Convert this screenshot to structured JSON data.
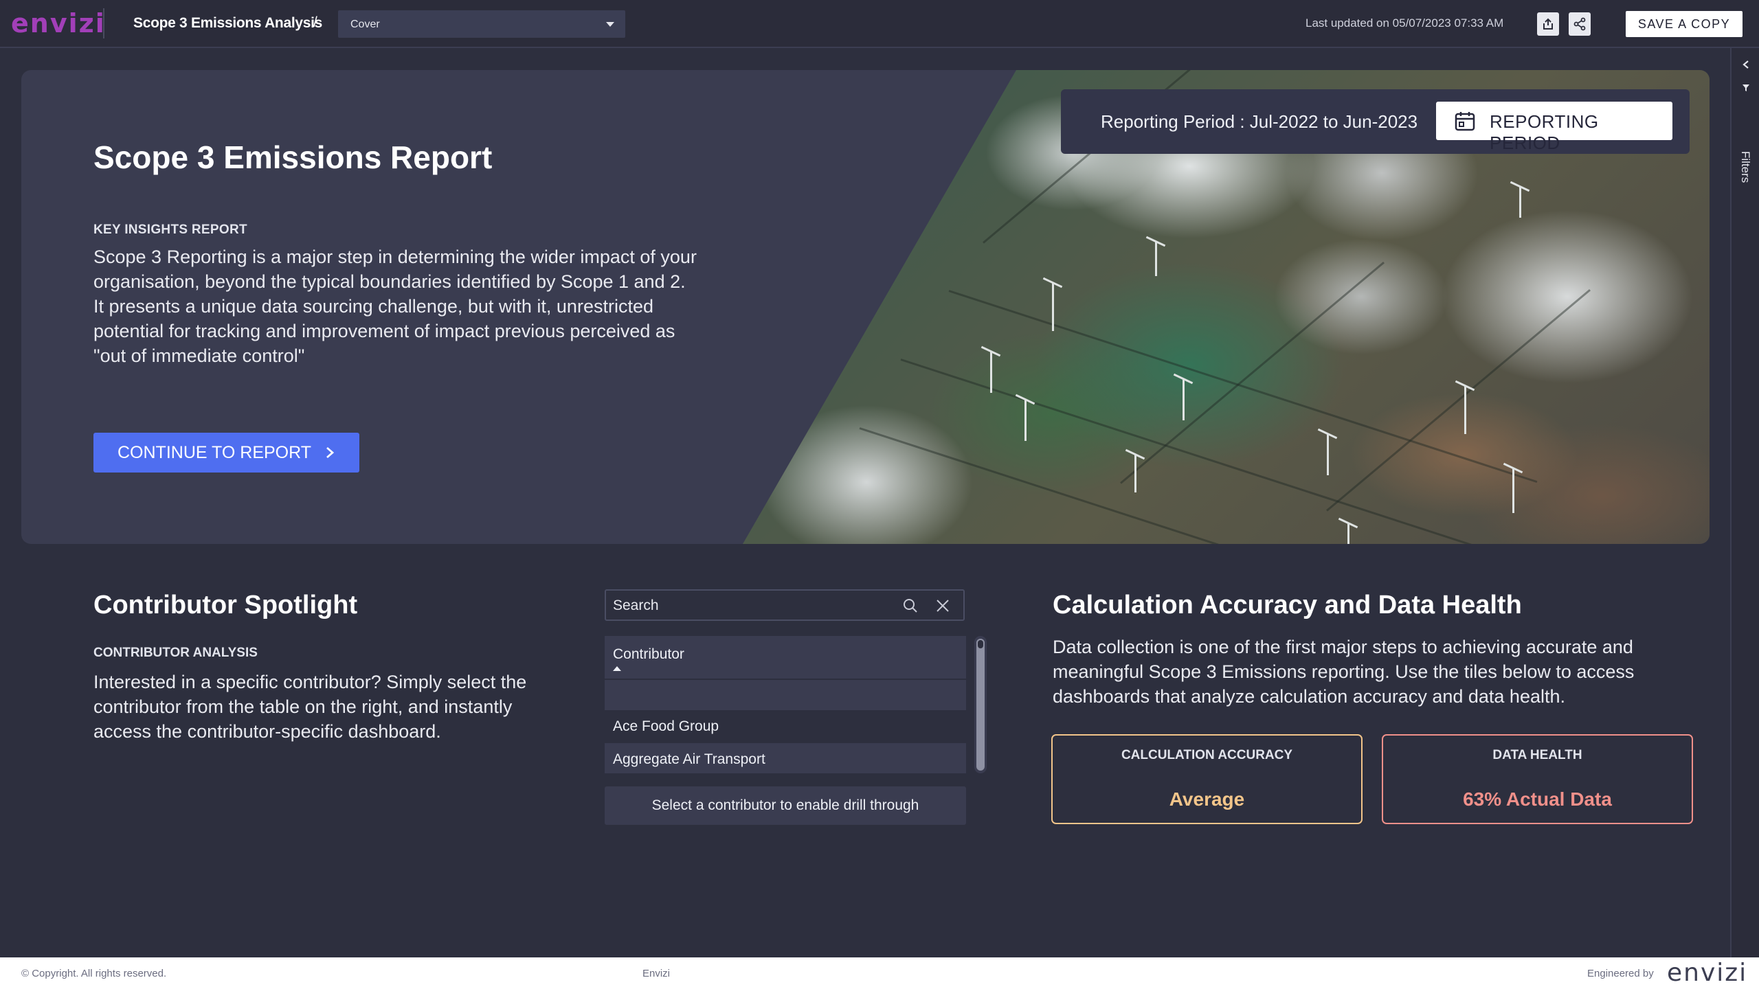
{
  "app": {
    "logo_text": "envizi",
    "report_name": "Scope 3 Emissions Analysis",
    "breadcrumb_separator": "/",
    "page_select": {
      "selected": "Cover"
    },
    "last_updated": "Last updated on 05/07/2023 07:33 AM",
    "save_copy_label": "SAVE A COPY",
    "filters_label": "Filters"
  },
  "hero": {
    "title": "Scope 3 Emissions Report",
    "eyebrow": "KEY INSIGHTS REPORT",
    "body": "Scope 3 Reporting is a major step in determining the wider impact of your organisation, beyond the typical boundaries identified by Scope 1 and 2. It presents a unique data sourcing challenge, but with it, unrestricted potential for tracking and improvement of impact previous perceived as \"out of immediate control\"",
    "continue_label": "CONTINUE TO REPORT",
    "reporting_period_text": "Reporting Period : Jul-2022 to Jun-2023",
    "reporting_period_button": "REPORTING PERIOD"
  },
  "contributor": {
    "title": "Contributor Spotlight",
    "eyebrow": "CONTRIBUTOR ANALYSIS",
    "body": "Interested in a specific contributor? Simply select the contributor from the table on the right, and instantly access the contributor-specific dashboard.",
    "search_placeholder": "Search",
    "table_header": "Contributor",
    "rows": [
      "",
      "Ace Food Group",
      "Aggregate Air Transport"
    ],
    "drill_label": "Select a contributor to enable drill through"
  },
  "accuracy": {
    "title": "Calculation Accuracy and Data Health",
    "body": "Data collection is one of the first major steps to achieving accurate and meaningful Scope 3 Emissions reporting. Use the tiles below to access dashboards that analyze calculation accuracy and data health.",
    "tiles": [
      {
        "label": "CALCULATION ACCURACY",
        "value": "Average",
        "color": "#f2c58a"
      },
      {
        "label": "DATA HEALTH",
        "value": "63% Actual Data",
        "color": "#f0908a"
      }
    ]
  },
  "footer": {
    "copyright": "© Copyright. All rights reserved.",
    "center": "Envizi",
    "engineered_by": "Engineered by",
    "logo_text": "envizi"
  },
  "colors": {
    "accent": "#4f6ef0",
    "logo": "#a23fb8",
    "background": "#2d2f3e"
  },
  "icons": [
    "share-export-icon",
    "share-network-icon",
    "calendar-icon",
    "chevron-right-icon",
    "search-icon",
    "clear-icon",
    "collapse-chevron-icon",
    "filter-funnel-icon",
    "dropdown-caret-icon",
    "sort-ascending-icon"
  ]
}
